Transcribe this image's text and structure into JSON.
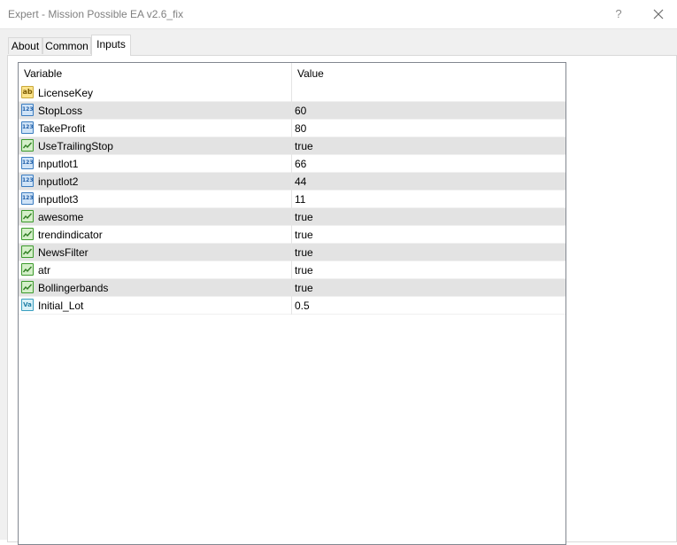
{
  "window": {
    "title": "Expert - Mission Possible EA v2.6_fix",
    "help_symbol": "?"
  },
  "tabs": [
    {
      "label": "About",
      "active": false
    },
    {
      "label": "Common",
      "active": false
    },
    {
      "label": "Inputs",
      "active": true
    }
  ],
  "grid": {
    "columns": [
      "Variable",
      "Value"
    ],
    "rows": [
      {
        "type": "string",
        "icon": "string-ab-icon",
        "variable": "LicenseKey",
        "value": ""
      },
      {
        "type": "int",
        "icon": "integer-123-icon",
        "variable": "StopLoss",
        "value": "60"
      },
      {
        "type": "int",
        "icon": "integer-123-icon",
        "variable": "TakeProfit",
        "value": "80"
      },
      {
        "type": "bool",
        "icon": "boolean-icon",
        "variable": "UseTrailingStop",
        "value": "true"
      },
      {
        "type": "int",
        "icon": "integer-123-icon",
        "variable": "inputlot1",
        "value": "66"
      },
      {
        "type": "int",
        "icon": "integer-123-icon",
        "variable": "inputlot2",
        "value": "44"
      },
      {
        "type": "int",
        "icon": "integer-123-icon",
        "variable": "inputlot3",
        "value": "11"
      },
      {
        "type": "bool",
        "icon": "boolean-icon",
        "variable": "awesome",
        "value": "true"
      },
      {
        "type": "bool",
        "icon": "boolean-icon",
        "variable": "trendindicator",
        "value": "true"
      },
      {
        "type": "bool",
        "icon": "boolean-icon",
        "variable": "NewsFilter",
        "value": "true"
      },
      {
        "type": "bool",
        "icon": "boolean-icon",
        "variable": "atr",
        "value": "true"
      },
      {
        "type": "bool",
        "icon": "boolean-icon",
        "variable": "Bollingerbands",
        "value": "true"
      },
      {
        "type": "double",
        "icon": "double-value-icon",
        "variable": "Initial_Lot",
        "value": "0.5"
      }
    ]
  },
  "colors": {
    "row_alt": "#e3e3e3",
    "grid_border": "#828790",
    "title_text": "#808080"
  }
}
